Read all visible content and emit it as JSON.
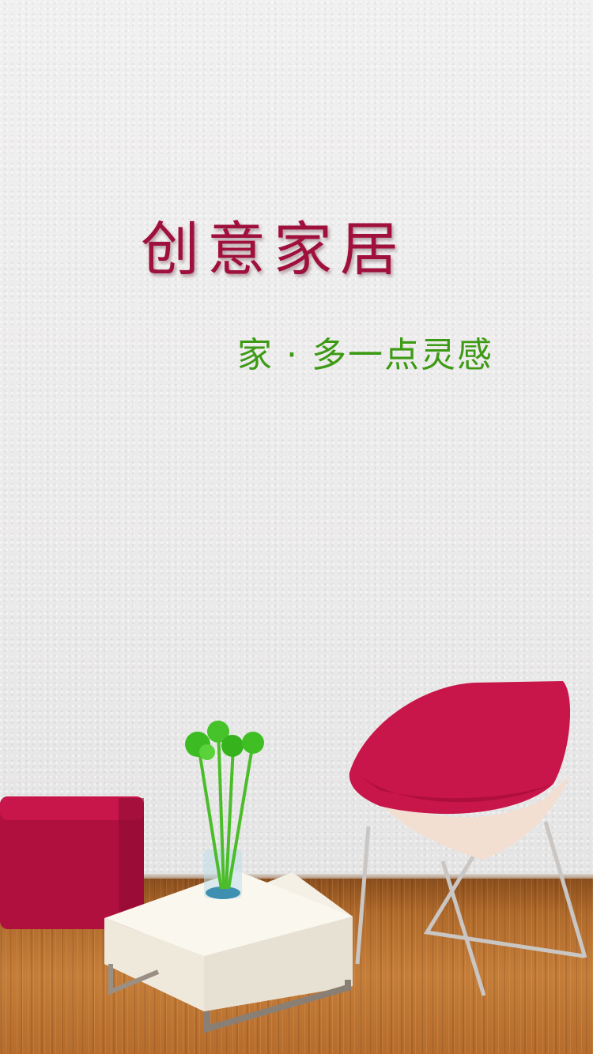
{
  "splash": {
    "title": "创意家居",
    "slogan": "家 · 多一点灵感"
  },
  "colors": {
    "title": "#a0103c",
    "slogan": "#3d9a14",
    "accent_furniture": "#c8154a"
  },
  "illustration": {
    "items": [
      "ottoman",
      "coffee-table",
      "vase-with-plants",
      "lounge-chair",
      "wood-floor"
    ]
  }
}
